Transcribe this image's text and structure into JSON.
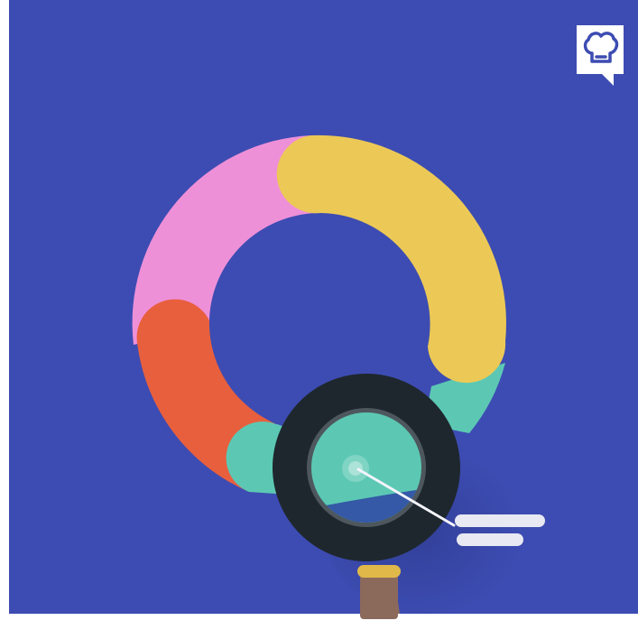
{
  "colors": {
    "background": "#3d4cb2",
    "frame": "#ffffff",
    "segment_pink": "#ee90d8",
    "segment_yellow": "#ecc956",
    "segment_teal": "#5cc8b4",
    "segment_orange": "#e85f3d",
    "magnifier_ring": "#1e272d",
    "magnifier_inner_rim": "#4d575d",
    "magnifier_lens_top": "#5cc8b4",
    "magnifier_lens_bottom": "#3559a6",
    "handle": "#8b6a5c",
    "handle_collar": "#e0b84a",
    "pointer_line": "#f4f4fb",
    "bars": "#e8e9f2",
    "badge": "#ffffff",
    "badge_icon": "#3d4cb2"
  },
  "icons": {
    "badge": "chef-hat-speech-bubble-icon",
    "magnifier": "magnifying-glass-icon"
  },
  "illustration": {
    "subject": "donut-chart-with-magnifying-glass",
    "segment_count": 4
  }
}
